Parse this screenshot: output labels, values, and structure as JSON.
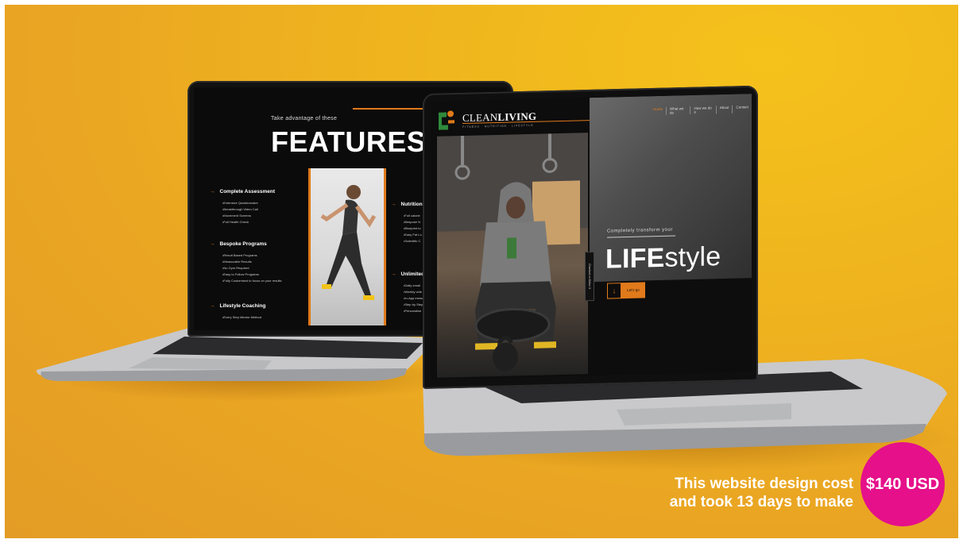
{
  "features_page": {
    "kicker": "Take advantage of these",
    "title": "FEATURES",
    "sections": [
      {
        "title": "Complete Assessment",
        "items": [
          "Extensive Questionnaire",
          "Breakthrough Video Call",
          "Movement Screens",
          "Full Health Check"
        ]
      },
      {
        "title": "Bespoke Programs",
        "items": [
          "Result Based Programs",
          "Measurable Results",
          "No Gym Required",
          "Easy to Follow Programs",
          "Fully Customised to focus on your results"
        ]
      },
      {
        "title": "Lifestyle Coaching",
        "items": [
          "Every Step Mentor Method"
        ]
      },
      {
        "title": "Nutrition",
        "items": [
          "Full calorie",
          "Bespoke N",
          "Blueprint to",
          "Easy Fat Lo",
          "Scientific C"
        ]
      },
      {
        "title": "Unlimited",
        "items": [
          "Daily email",
          "Weekly vide",
          "In-App mess",
          "Step by Step",
          "Personalise"
        ]
      }
    ]
  },
  "home_page": {
    "brand_light": "CLEAN",
    "brand_bold": "LIVING",
    "tagline": "FITNESS · NUTRITION · LIFESTYLE",
    "nav": [
      "Home",
      "What we do",
      "How we do it",
      "About",
      "Contact"
    ],
    "kicker": "Completely transform your",
    "headline_bold": "LIFE",
    "headline_light": "style",
    "cta_icon": "↓",
    "cta_label": "Let's go",
    "side_tab": "Checked on Editor X"
  },
  "caption": {
    "line1": "This website design cost",
    "line2": "and took 13 days to make"
  },
  "badge": {
    "price": "$140 USD"
  },
  "colors": {
    "accent_orange": "#e07a1b",
    "badge_pink": "#e5108a",
    "background_yellow": "#efb41e"
  }
}
